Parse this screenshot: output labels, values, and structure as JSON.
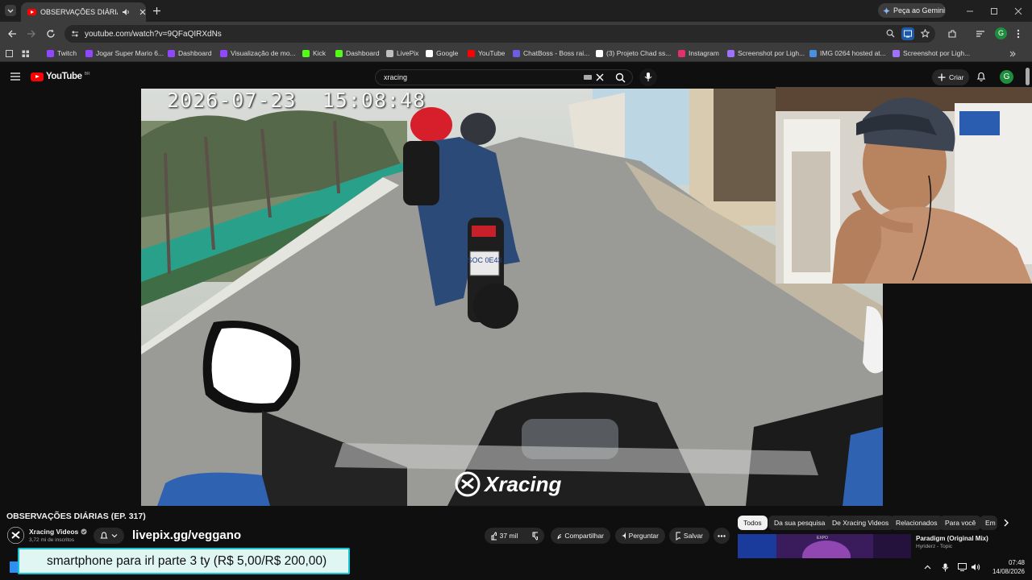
{
  "browser": {
    "tab_title": "OBSERVAÇÕES DIÁRIAS (EP.",
    "gemini_label": "Peça ao Gemini",
    "url": "youtube.com/watch?v=9QFaQIRXdNs",
    "profile_initial": "G"
  },
  "bookmarks": [
    {
      "label": "Twitch",
      "icon": "twitch-icon",
      "color": "#9146ff"
    },
    {
      "label": "Jogar Super Mario 6...",
      "icon": "twitch-icon",
      "color": "#9146ff"
    },
    {
      "label": "Dashboard",
      "icon": "twitch-icon",
      "color": "#9146ff"
    },
    {
      "label": "Visualização de mo...",
      "icon": "twitch-icon",
      "color": "#9146ff"
    },
    {
      "label": "Kick",
      "icon": "kick-icon",
      "color": "#53fc18"
    },
    {
      "label": "Dashboard",
      "icon": "kick-icon",
      "color": "#53fc18"
    },
    {
      "label": "LivePix",
      "icon": "livepix-icon",
      "color": "#bfbfbf"
    },
    {
      "label": "Google",
      "icon": "google-icon",
      "color": "#ffffff"
    },
    {
      "label": "YouTube",
      "icon": "youtube-icon",
      "color": "#ff0000"
    },
    {
      "label": "ChatBoss - Boss rai...",
      "icon": "chatboss-icon",
      "color": "#6c5ce7"
    },
    {
      "label": "(3) Projeto Chad ss...",
      "icon": "x-icon",
      "color": "#ffffff"
    },
    {
      "label": "Instagram",
      "icon": "instagram-icon",
      "color": "#e1306c"
    },
    {
      "label": "Screenshot por Ligh...",
      "icon": "lightshot-icon",
      "color": "#a070ff"
    },
    {
      "label": "IMG 0264 hosted at...",
      "icon": "imgbb-icon",
      "color": "#4a90e2"
    },
    {
      "label": "Screenshot por Ligh...",
      "icon": "lightshot-icon",
      "color": "#a070ff"
    }
  ],
  "youtube": {
    "logo": "YouTube",
    "logo_suffix": "BR",
    "search_value": "xracing",
    "create_label": "Criar",
    "avatar_initial": "G"
  },
  "video": {
    "timestamp": "2026-07-23  15:08:48",
    "plate": "SOC 0E43",
    "watermark": "Xracing",
    "title": "OBSERVAÇÕES DIÁRIAS (EP. 317)"
  },
  "channel": {
    "name": "Xracing Videos",
    "subscribers": "3,72 mi de inscritos",
    "overlay_link": "livepix.gg/veggano"
  },
  "actions": {
    "likes": "37 mil",
    "share": "Compartilhar",
    "ask": "Perguntar",
    "save": "Salvar"
  },
  "chips": [
    "Todos",
    "Da sua pesquisa",
    "De Xracing Videos",
    "Relacionados",
    "Para você",
    "Em"
  ],
  "recommended": {
    "title": "Paradigm (Original Mix)",
    "channel": "Hyriderz - Topic",
    "thumb_text": "EXPO"
  },
  "donation": {
    "text": "smartphone para irl parte 3 ty (R$ 5,00/R$ 200,00)"
  },
  "system": {
    "time": "07:48",
    "date": "14/08/2026"
  }
}
